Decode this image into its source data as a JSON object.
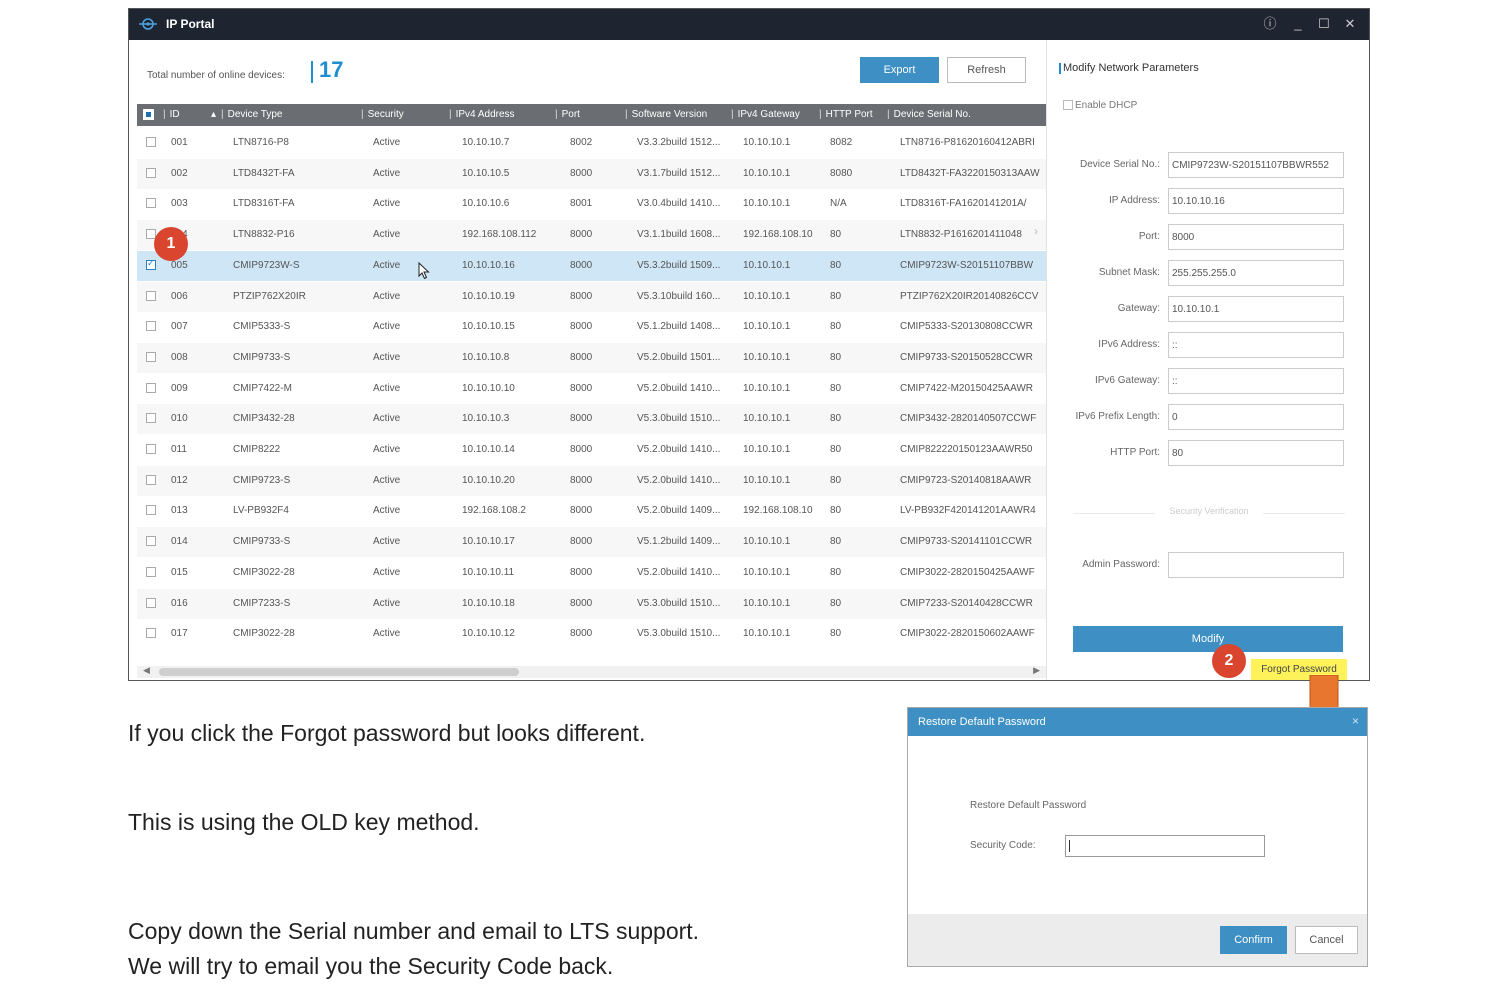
{
  "window": {
    "title": "IP Portal",
    "controls": [
      "ⓘ",
      "_",
      "☐",
      "✕"
    ]
  },
  "summary": {
    "count_label": "Total number of online devices:",
    "count_value": "17"
  },
  "toolbar": {
    "export_label": "Export",
    "refresh_label": "Refresh"
  },
  "table": {
    "headers": [
      "ID",
      "Device Type",
      "Security",
      "IPv4 Address",
      "Port",
      "Software Version",
      "IPv4 Gateway",
      "HTTP Port",
      "Device Serial No."
    ],
    "sort_indicator": "▴",
    "rows": [
      {
        "id": "001",
        "type": "LTN8716-P8",
        "security": "Active",
        "ip": "10.10.10.7",
        "port": "8002",
        "sw": "V3.3.2build 1512...",
        "gw": "10.10.10.1",
        "http": "8082",
        "serial": "LTN8716-P81620160412ABRI"
      },
      {
        "id": "002",
        "type": "LTD8432T-FA",
        "security": "Active",
        "ip": "10.10.10.5",
        "port": "8000",
        "sw": "V3.1.7build 1512...",
        "gw": "10.10.10.1",
        "http": "8080",
        "serial": "LTD8432T-FA3220150313AAW"
      },
      {
        "id": "003",
        "type": "LTD8316T-FA",
        "security": "Active",
        "ip": "10.10.10.6",
        "port": "8001",
        "sw": "V3.0.4build 1410...",
        "gw": "10.10.10.1",
        "http": "N/A",
        "serial": "LTD8316T-FA1620141201A/"
      },
      {
        "id": "004",
        "type": "LTN8832-P16",
        "security": "Active",
        "ip": "192.168.108.112",
        "port": "8000",
        "sw": "V3.1.1build 1608...",
        "gw": "192.168.108.10",
        "http": "80",
        "serial": "LTN8832-P1616201411048"
      },
      {
        "id": "005",
        "type": "CMIP9723W-S",
        "security": "Active",
        "ip": "10.10.10.16",
        "port": "8000",
        "sw": "V5.3.2build 1509...",
        "gw": "10.10.10.1",
        "http": "80",
        "serial": "CMIP9723W-S20151107BBW"
      },
      {
        "id": "006",
        "type": "PTZIP762X20IR",
        "security": "Active",
        "ip": "10.10.10.19",
        "port": "8000",
        "sw": "V5.3.10build 160...",
        "gw": "10.10.10.1",
        "http": "80",
        "serial": "PTZIP762X20IR20140826CCV"
      },
      {
        "id": "007",
        "type": "CMIP5333-S",
        "security": "Active",
        "ip": "10.10.10.15",
        "port": "8000",
        "sw": "V5.1.2build 1408...",
        "gw": "10.10.10.1",
        "http": "80",
        "serial": "CMIP5333-S20130808CCWR"
      },
      {
        "id": "008",
        "type": "CMIP9733-S",
        "security": "Active",
        "ip": "10.10.10.8",
        "port": "8000",
        "sw": "V5.2.0build 1501...",
        "gw": "10.10.10.1",
        "http": "80",
        "serial": "CMIP9733-S20150528CCWR"
      },
      {
        "id": "009",
        "type": "CMIP7422-M",
        "security": "Active",
        "ip": "10.10.10.10",
        "port": "8000",
        "sw": "V5.2.0build 1410...",
        "gw": "10.10.10.1",
        "http": "80",
        "serial": "CMIP7422-M20150425AAWR"
      },
      {
        "id": "010",
        "type": "CMIP3432-28",
        "security": "Active",
        "ip": "10.10.10.3",
        "port": "8000",
        "sw": "V5.3.0build 1510...",
        "gw": "10.10.10.1",
        "http": "80",
        "serial": "CMIP3432-2820140507CCWF"
      },
      {
        "id": "011",
        "type": "CMIP8222",
        "security": "Active",
        "ip": "10.10.10.14",
        "port": "8000",
        "sw": "V5.2.0build 1410...",
        "gw": "10.10.10.1",
        "http": "80",
        "serial": "CMIP822220150123AAWR50"
      },
      {
        "id": "012",
        "type": "CMIP9723-S",
        "security": "Active",
        "ip": "10.10.10.20",
        "port": "8000",
        "sw": "V5.2.0build 1410...",
        "gw": "10.10.10.1",
        "http": "80",
        "serial": "CMIP9723-S20140818AAWR"
      },
      {
        "id": "013",
        "type": "LV-PB932F4",
        "security": "Active",
        "ip": "192.168.108.2",
        "port": "8000",
        "sw": "V5.2.0build 1409...",
        "gw": "192.168.108.10",
        "http": "80",
        "serial": "LV-PB932F420141201AAWR4"
      },
      {
        "id": "014",
        "type": "CMIP9733-S",
        "security": "Active",
        "ip": "10.10.10.17",
        "port": "8000",
        "sw": "V5.1.2build 1409...",
        "gw": "10.10.10.1",
        "http": "80",
        "serial": "CMIP9733-S20141101CCWR"
      },
      {
        "id": "015",
        "type": "CMIP3022-28",
        "security": "Active",
        "ip": "10.10.10.11",
        "port": "8000",
        "sw": "V5.2.0build 1410...",
        "gw": "10.10.10.1",
        "http": "80",
        "serial": "CMIP3022-2820150425AAWF"
      },
      {
        "id": "016",
        "type": "CMIP7233-S",
        "security": "Active",
        "ip": "10.10.10.18",
        "port": "8000",
        "sw": "V5.3.0build 1510...",
        "gw": "10.10.10.1",
        "http": "80",
        "serial": "CMIP7233-S20140428CCWR"
      },
      {
        "id": "017",
        "type": "CMIP3022-28",
        "security": "Active",
        "ip": "10.10.10.12",
        "port": "8000",
        "sw": "V5.3.0build 1510...",
        "gw": "10.10.10.1",
        "http": "80",
        "serial": "CMIP3022-2820150602AAWF"
      }
    ]
  },
  "panel": {
    "title": "Modify Network Parameters",
    "dhcp_label": "Enable DHCP",
    "fields": [
      {
        "label": "Device Serial No.:",
        "value": "CMIP9723W-S20151107BBWR552"
      },
      {
        "label": "IP Address:",
        "value": "10.10.10.16"
      },
      {
        "label": "Port:",
        "value": "8000"
      },
      {
        "label": "Subnet Mask:",
        "value": "255.255.255.0"
      },
      {
        "label": "Gateway:",
        "value": "10.10.10.1"
      },
      {
        "label": "IPv6 Address:",
        "value": "::"
      },
      {
        "label": "IPv6 Gateway:",
        "value": "::"
      },
      {
        "label": "IPv6 Prefix Length:",
        "value": "0"
      },
      {
        "label": "HTTP Port:",
        "value": "80"
      }
    ],
    "security_verification": "Security Verification",
    "admin_password_label": "Admin Password:",
    "modify_label": "Modify",
    "forgot_label": "Forgot Password"
  },
  "badges": {
    "one": "1",
    "two": "2"
  },
  "dialog": {
    "title": "Restore Default Password",
    "close": "×",
    "subtitle": "Restore Default Password",
    "code_label": "Security Code:",
    "confirm_label": "Confirm",
    "cancel_label": "Cancel"
  },
  "doc": {
    "line1": "If you click the Forgot password but looks different.",
    "line2": "This is using the OLD key method.",
    "line3": "Copy down the Serial number and email to LTS support.",
    "line4": "We will try to email you the Security Code back."
  },
  "colors": {
    "accent": "#3d8fc4",
    "count": "#1f8ed0",
    "highlight": "#fdf25a",
    "badge": "#d9452f",
    "arrow": "#e8762e",
    "titlebar": "#1e2530"
  }
}
